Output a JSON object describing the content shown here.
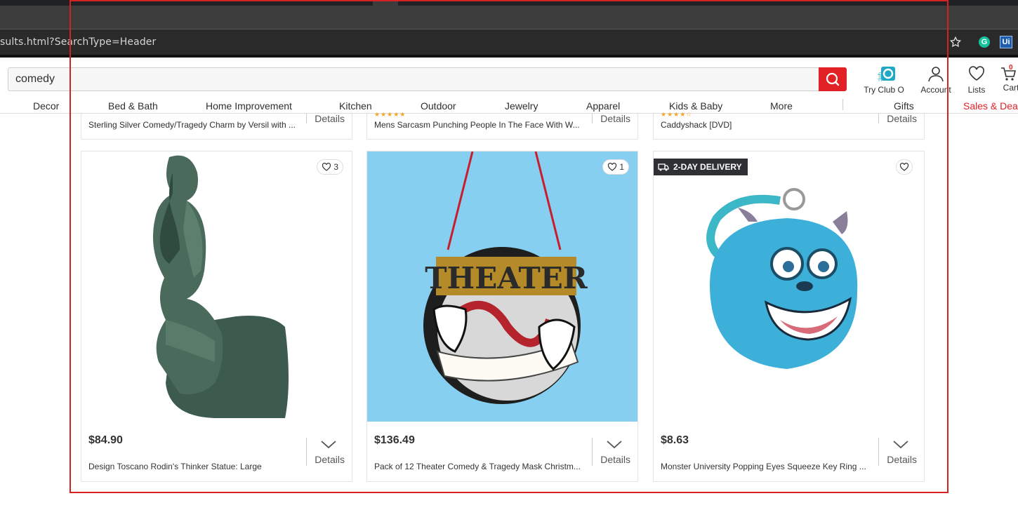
{
  "browser": {
    "url": "sults.html?SearchType=Header",
    "grammarly": "G",
    "ext": "Ui"
  },
  "search": {
    "value": "comedy"
  },
  "header_icons": {
    "club_label": "Try Club O",
    "club_badge": "club",
    "account_label": "Account",
    "lists_label": "Lists",
    "cart_label": "Cart",
    "cart_count": "0"
  },
  "nav": [
    "Decor",
    "Bed & Bath",
    "Home Improvement",
    "Kitchen",
    "Outdoor",
    "Jewelry",
    "Apparel",
    "Kids & Baby",
    "More",
    "Gifts",
    "Sales & Deals"
  ],
  "top_row": [
    {
      "title": "Sterling Silver Comedy/Tragedy Charm by Versil with ...",
      "details": "Details",
      "stars": ""
    },
    {
      "title": "Mens Sarcasm Punching People In The Face With W...",
      "details": "Details",
      "stars": "★★★★★"
    },
    {
      "title": "Caddyshack [DVD]",
      "details": "Details",
      "stars": "★★★★☆"
    }
  ],
  "products": [
    {
      "price": "$84.90",
      "title": "Design Toscano Rodin's Thinker Statue: Large",
      "favorites": "3",
      "details": "Details"
    },
    {
      "price": "$136.49",
      "title": "Pack of 12 Theater Comedy & Tragedy Mask Christm...",
      "favorites": "1",
      "details": "Details",
      "art_text": "THEATER"
    },
    {
      "price": "$8.63",
      "title": "Monster University Popping Eyes Squeeze Key Ring ...",
      "favorites": "",
      "details": "Details",
      "badge": "2-DAY DELIVERY"
    }
  ]
}
